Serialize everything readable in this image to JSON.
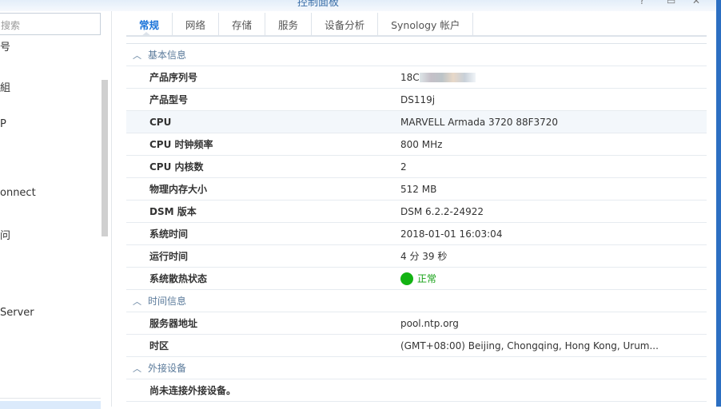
{
  "window": {
    "title": "控制面板"
  },
  "sidebar": {
    "search_placeholder": "搜索",
    "items": [
      "号",
      "組",
      "P",
      "onnect",
      "问",
      "Server"
    ]
  },
  "tabs": [
    "常规",
    "网络",
    "存储",
    "服务",
    "设备分析",
    "Synology 帐户"
  ],
  "sections": [
    {
      "title": "基本信息",
      "rows": [
        {
          "label": "产品序列号",
          "value": "18C"
        },
        {
          "label": "产品型号",
          "value": "DS119j"
        },
        {
          "label": "CPU",
          "value": "MARVELL Armada 3720 88F3720"
        },
        {
          "label": "CPU 时钟频率",
          "value": "800 MHz"
        },
        {
          "label": "CPU 内核数",
          "value": "2"
        },
        {
          "label": "物理内存大小",
          "value": "512 MB"
        },
        {
          "label": "DSM 版本",
          "value": "DSM 6.2.2-24922"
        },
        {
          "label": "系统时间",
          "value": "2018-01-01 16:03:04"
        },
        {
          "label": "运行时间",
          "value": "4 分 39 秒"
        },
        {
          "label": "系统散热状态",
          "value": "正常"
        }
      ]
    },
    {
      "title": "时间信息",
      "rows": [
        {
          "label": "服务器地址",
          "value": "pool.ntp.org"
        },
        {
          "label": "时区",
          "value": "(GMT+08:00) Beijing, Chongqing, Hong Kong, Urum..."
        }
      ]
    },
    {
      "title": "外接设备",
      "rows": [
        {
          "label": "尚未连接外接设备。",
          "value": ""
        }
      ]
    }
  ],
  "colors": {
    "accent": "#1a73d9",
    "status_ok": "#13b313"
  }
}
